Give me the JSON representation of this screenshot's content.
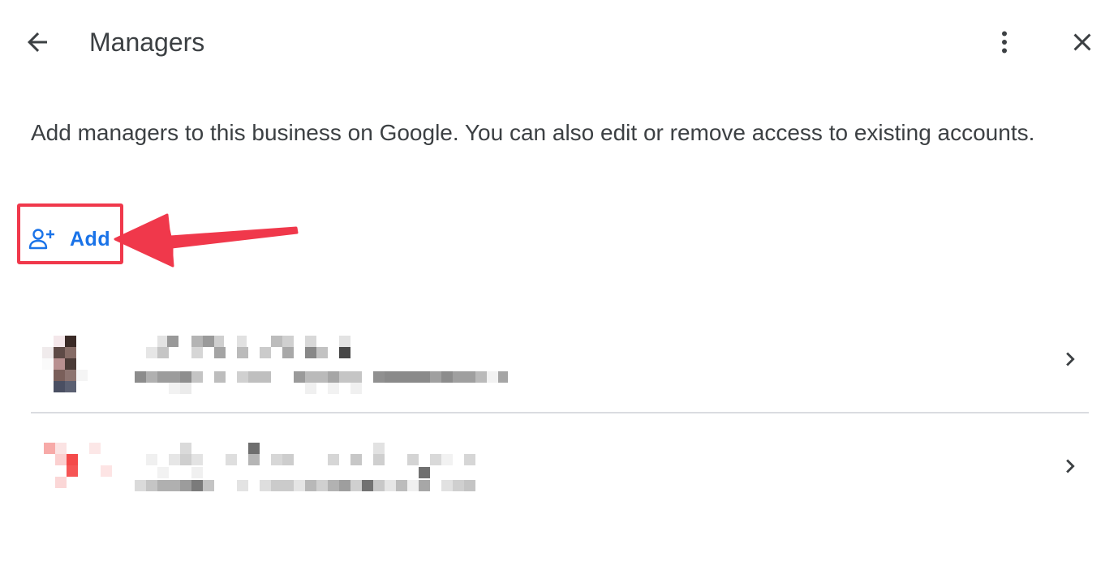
{
  "header": {
    "title": "Managers",
    "back_icon": "arrow-back-icon",
    "more_icon": "more-vert-icon",
    "close_icon": "close-icon"
  },
  "description": "Add managers to this business on Google. You can also edit or remove access to existing accounts.",
  "add_button": {
    "label": "Add",
    "icon": "person-add-icon",
    "color": "#1a73e8"
  },
  "annotation": {
    "highlight_color": "#f0384b"
  },
  "managers": [
    {
      "avatar": "pixelated-avatar",
      "chevron": "chevron-right-icon"
    },
    {
      "avatar": "pixelated-avatar",
      "chevron": "chevron-right-icon"
    }
  ]
}
